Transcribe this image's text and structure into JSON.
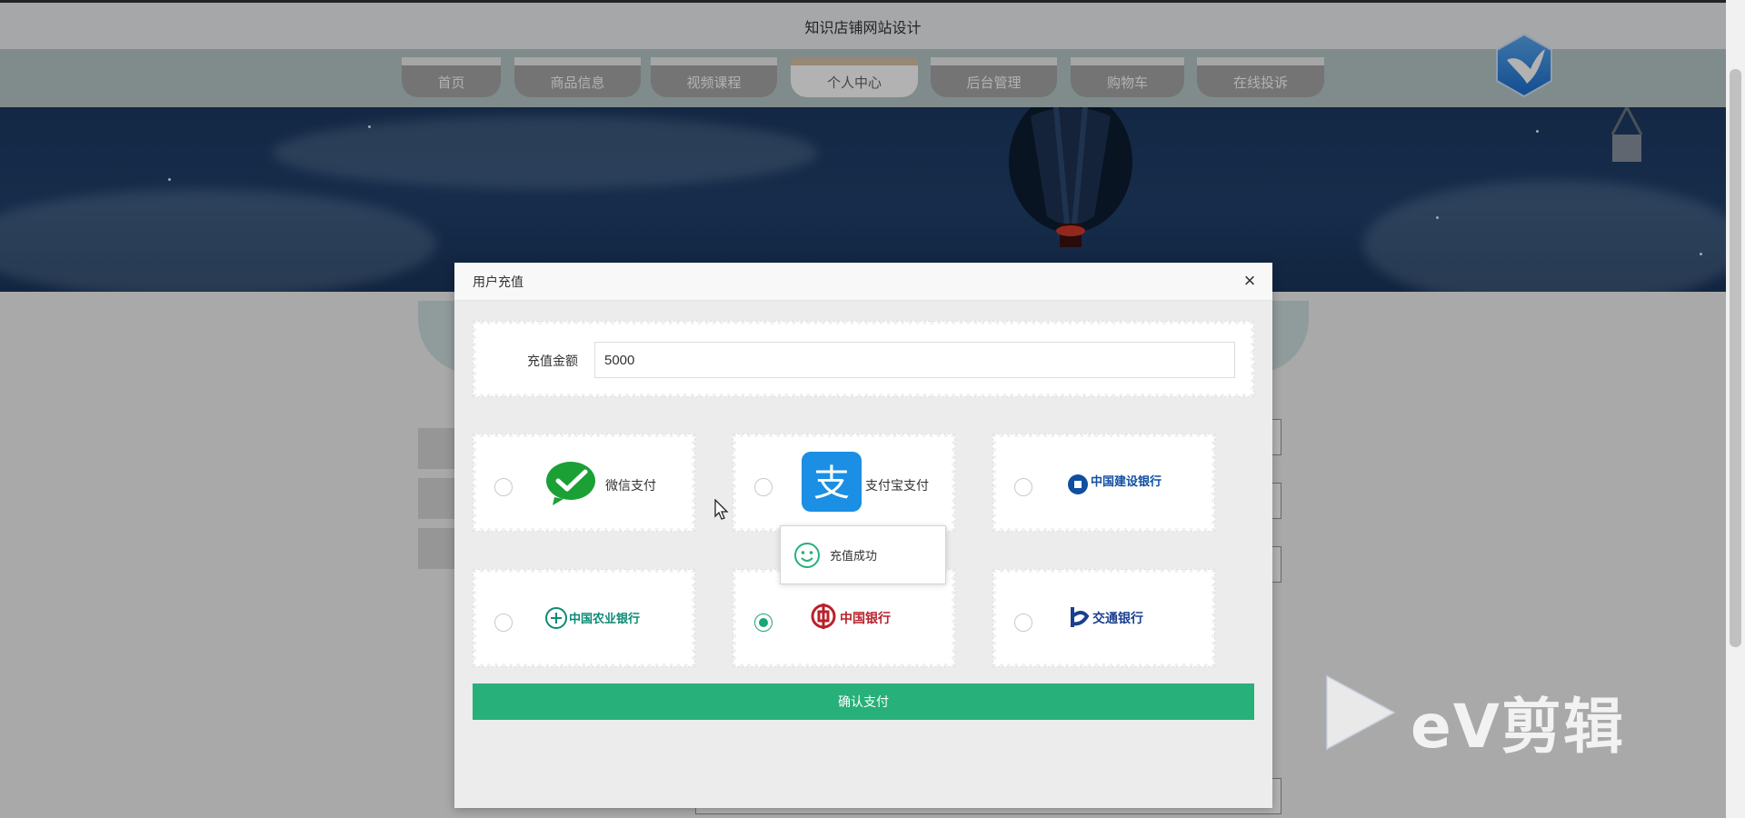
{
  "site_title": "知识店铺网站设计",
  "nav": [
    {
      "label": "首页",
      "active": false
    },
    {
      "label": "商品信息",
      "active": false
    },
    {
      "label": "视频课程",
      "active": false
    },
    {
      "label": "个人中心",
      "active": true
    },
    {
      "label": "后台管理",
      "active": false
    },
    {
      "label": "购物车",
      "active": false
    },
    {
      "label": "在线投诉",
      "active": false
    }
  ],
  "logo_icon": "bird-hexagon-logo-icon",
  "modal": {
    "title": "用户充值",
    "close_icon": "close-icon",
    "amount_label": "充值金额",
    "amount_value": "5000",
    "payment_methods": [
      {
        "label": "微信支付",
        "icon": "wechat-pay-icon",
        "selected": false
      },
      {
        "label": "支付宝支付",
        "icon": "alipay-icon",
        "selected": false
      },
      {
        "label": "中国建设银行",
        "icon": "ccb-logo",
        "selected": false
      },
      {
        "label": "中国农业银行",
        "icon": "abc-logo",
        "selected": false
      },
      {
        "label": "中国银行",
        "icon": "boc-logo",
        "selected": true
      },
      {
        "label": "交通银行",
        "icon": "bocom-logo",
        "selected": false
      }
    ],
    "confirm_label": "确认支付"
  },
  "toast": {
    "message": "充值成功",
    "icon": "smiley-icon"
  },
  "watermark": "eV剪辑",
  "colors": {
    "accent": "#27b07a",
    "nav_bar": "#b8c8c9",
    "tab": "#a7a7a7",
    "radio_checked": "#1aa57a"
  }
}
